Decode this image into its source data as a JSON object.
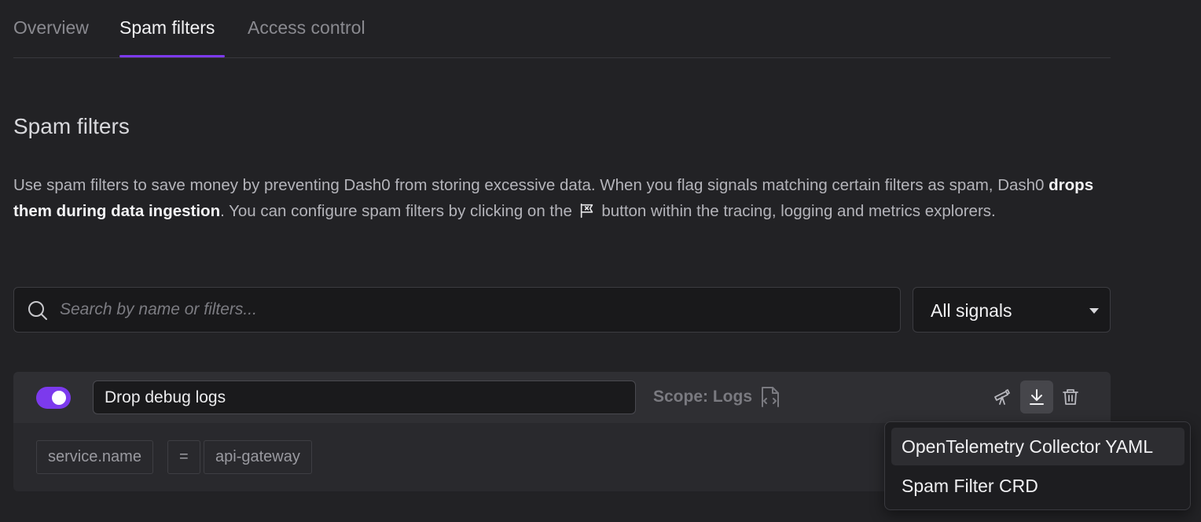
{
  "tabs": [
    {
      "label": "Overview",
      "active": false
    },
    {
      "label": "Spam filters",
      "active": true
    },
    {
      "label": "Access control",
      "active": false
    }
  ],
  "colors": {
    "accent": "#7c3aed",
    "background": "#222225"
  },
  "page": {
    "title": "Spam filters",
    "description": {
      "part1": "Use spam filters to save money by preventing Dash0 from storing excessive data. When you flag signals matching certain filters as spam, Dash0 ",
      "bold": "drops them during data ingestion",
      "part2": ". You can configure spam filters by clicking on the ",
      "icon": "flag-icon",
      "part3": " button within the tracing, logging and metrics explorers."
    }
  },
  "search": {
    "placeholder": "Search by name or filters...",
    "value": ""
  },
  "signal_select": {
    "selected": "All signals"
  },
  "filter": {
    "enabled": true,
    "name": "Drop debug logs",
    "scope_label": "Scope: Logs",
    "scope_icon": "file-code-icon",
    "actions": [
      "telescope-icon",
      "download-icon",
      "trash-icon"
    ],
    "condition": {
      "key": "service.name",
      "operator": "=",
      "value": "api-gateway"
    }
  },
  "download_menu": {
    "items": [
      {
        "label": "OpenTelemetry Collector YAML"
      },
      {
        "label": "Spam Filter CRD"
      }
    ]
  }
}
